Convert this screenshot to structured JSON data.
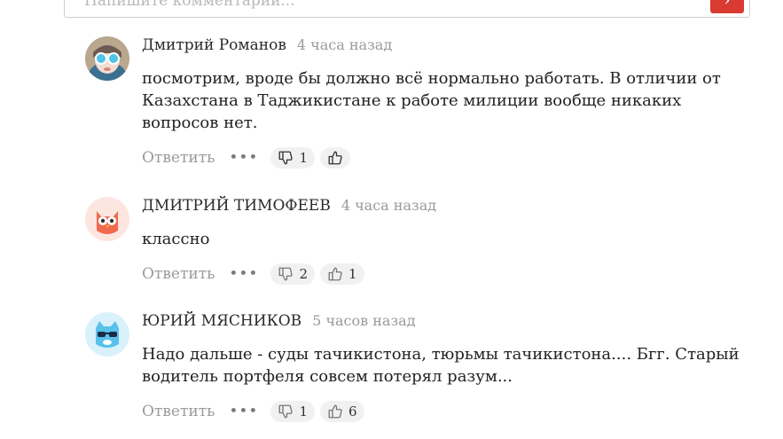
{
  "composer": {
    "placeholder": "Напишите комментарий...",
    "send_icon": "›"
  },
  "comments": [
    {
      "author": "Дмитрий Романов",
      "time": "4 часа назад",
      "text": "посмотрим, вроде бы должно всё нормально работать. В отличии от Казахстана в Таджикистане к работе милиции вообще никаких вопросов нет.",
      "reply_label": "Ответить",
      "more": "•••",
      "dislikes": "1",
      "likes": "",
      "avatar": "goggles-avatar"
    },
    {
      "author": "ДМИТРИЙ ТИМОФЕЕВ",
      "time": "4 часа назад",
      "text": "классно",
      "reply_label": "Ответить",
      "more": "•••",
      "dislikes": "2",
      "likes": "1",
      "avatar": "owl-avatar"
    },
    {
      "author": "ЮРИЙ МЯСНИКОВ",
      "time": "5 часов назад",
      "text": "Надо дальше - суды тачикистона, тюрьмы тачикистона.... Бгг. Старый водитель портфеля совсем потерял разум...",
      "reply_label": "Ответить",
      "more": "•••",
      "dislikes": "1",
      "likes": "6",
      "avatar": "cat-sunglasses-avatar"
    }
  ],
  "colors": {
    "accent": "#d93a31",
    "muted_text": "#9a9a9a",
    "vote_bg": "#f1f1f1"
  }
}
